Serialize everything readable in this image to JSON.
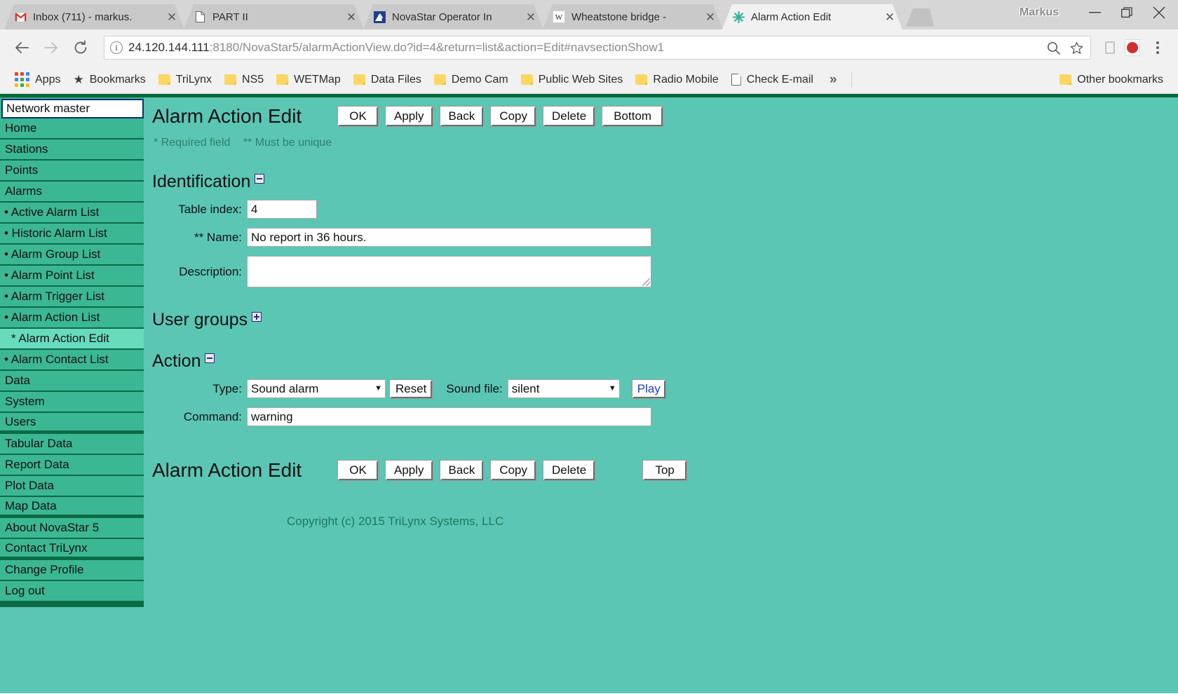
{
  "browser": {
    "profile_name": "Markus",
    "tabs": [
      {
        "title": "Inbox (711) - markus.",
        "favicon": "gmail-icon",
        "active": false
      },
      {
        "title": "PART II",
        "favicon": "document-icon",
        "active": false
      },
      {
        "title": "NovaStar Operator In",
        "favicon": "novastar-icon",
        "active": false
      },
      {
        "title": "Wheatstone bridge -",
        "favicon": "wikipedia-icon",
        "active": false
      },
      {
        "title": "Alarm Action Edit",
        "favicon": "novastar-star-icon",
        "active": true
      }
    ],
    "url": {
      "host": "24.120.144.111",
      "path": ":8180/NovaStar5/alarmActionView.do?id=4&return=list&action=Edit#navsectionShow1",
      "security_label": "i"
    },
    "window_controls": {
      "minimize": "minimize-icon",
      "maximize": "maximize-icon",
      "close": "close-icon"
    },
    "bookmarks": [
      {
        "label": "Apps",
        "icon": "apps-grid-icon"
      },
      {
        "label": "Bookmarks",
        "icon": "star-icon"
      },
      {
        "label": "TriLynx",
        "icon": "folder-icon"
      },
      {
        "label": "NS5",
        "icon": "folder-icon"
      },
      {
        "label": "WETMap",
        "icon": "folder-icon"
      },
      {
        "label": "Data Files",
        "icon": "folder-icon"
      },
      {
        "label": "Demo Cam",
        "icon": "folder-icon"
      },
      {
        "label": "Public Web Sites",
        "icon": "folder-icon"
      },
      {
        "label": "Radio Mobile",
        "icon": "folder-icon"
      },
      {
        "label": "Check E-mail",
        "icon": "page-icon"
      }
    ],
    "bookmarks_overflow": "»",
    "other_bookmarks": {
      "label": "Other bookmarks",
      "icon": "folder-icon"
    }
  },
  "sidebar": {
    "site_selector": {
      "value": "Network master"
    },
    "items": [
      {
        "label": "Home",
        "type": "top",
        "current": false
      },
      {
        "label": "Stations",
        "type": "top",
        "current": false
      },
      {
        "label": "Points",
        "type": "top",
        "current": false
      },
      {
        "label": "Alarms",
        "type": "top",
        "current": false
      },
      {
        "label": "• Active Alarm List",
        "type": "sub",
        "current": false
      },
      {
        "label": "• Historic Alarm List",
        "type": "sub",
        "current": false
      },
      {
        "label": "• Alarm Group List",
        "type": "sub",
        "current": false
      },
      {
        "label": "• Alarm Point List",
        "type": "sub",
        "current": false
      },
      {
        "label": "• Alarm Trigger List",
        "type": "sub",
        "current": false
      },
      {
        "label": "• Alarm Action List",
        "type": "sub",
        "current": false
      },
      {
        "label": "* Alarm Action Edit",
        "type": "sub",
        "current": true
      },
      {
        "label": "• Alarm Contact List",
        "type": "sub",
        "current": false
      },
      {
        "label": "Data",
        "type": "top",
        "current": false
      },
      {
        "label": "System",
        "type": "top",
        "current": false
      },
      {
        "label": "Users",
        "type": "gap",
        "current": false
      },
      {
        "label": "Tabular Data",
        "type": "top",
        "current": false
      },
      {
        "label": "Report Data",
        "type": "top",
        "current": false
      },
      {
        "label": "Plot Data",
        "type": "top",
        "current": false
      },
      {
        "label": "Map Data",
        "type": "gap",
        "current": false
      },
      {
        "label": "About NovaStar 5",
        "type": "top",
        "current": false
      },
      {
        "label": "Contact TriLynx",
        "type": "gap",
        "current": false
      },
      {
        "label": "Change Profile",
        "type": "top",
        "current": false
      },
      {
        "label": "Log out",
        "type": "top",
        "current": false
      }
    ]
  },
  "main": {
    "page_title": "Alarm Action Edit",
    "toolbar_top": {
      "ok": "OK",
      "apply": "Apply",
      "back": "Back",
      "copy": "Copy",
      "delete": "Delete",
      "bottom": "Bottom"
    },
    "toolbar_bottom": {
      "title": "Alarm Action Edit",
      "ok": "OK",
      "apply": "Apply",
      "back": "Back",
      "copy": "Copy",
      "delete": "Delete",
      "top": "Top"
    },
    "legend": {
      "required": "* Required field",
      "unique": "** Must be unique"
    },
    "sections": {
      "identification": {
        "heading": "Identification",
        "toggle_state": "collapse",
        "fields": {
          "table_index_label": "Table index:",
          "table_index_value": "4",
          "name_label": "** Name:",
          "name_value": "No report in 36 hours.",
          "description_label": "Description:",
          "description_value": ""
        }
      },
      "user_groups": {
        "heading": "User groups",
        "toggle_state": "expand"
      },
      "action": {
        "heading": "Action",
        "toggle_state": "collapse",
        "fields": {
          "type_label": "Type:",
          "type_value": "Sound alarm",
          "reset_label": "Reset",
          "sound_file_label": "Sound file:",
          "sound_file_value": "silent",
          "play_label": "Play",
          "command_label": "Command:",
          "command_value": "warning"
        }
      }
    },
    "copyright": "Copyright (c) 2015 TriLynx Systems, LLC"
  },
  "colors": {
    "page_background": "#5bc6b4",
    "sidebar_background": "#3cb793",
    "sidebar_current": "#68dbbd",
    "sidebar_divider": "#0a6b45",
    "top_rule": "#006837",
    "copyright_text": "#1c7a60",
    "link_button_text": "#1e3fc4"
  }
}
